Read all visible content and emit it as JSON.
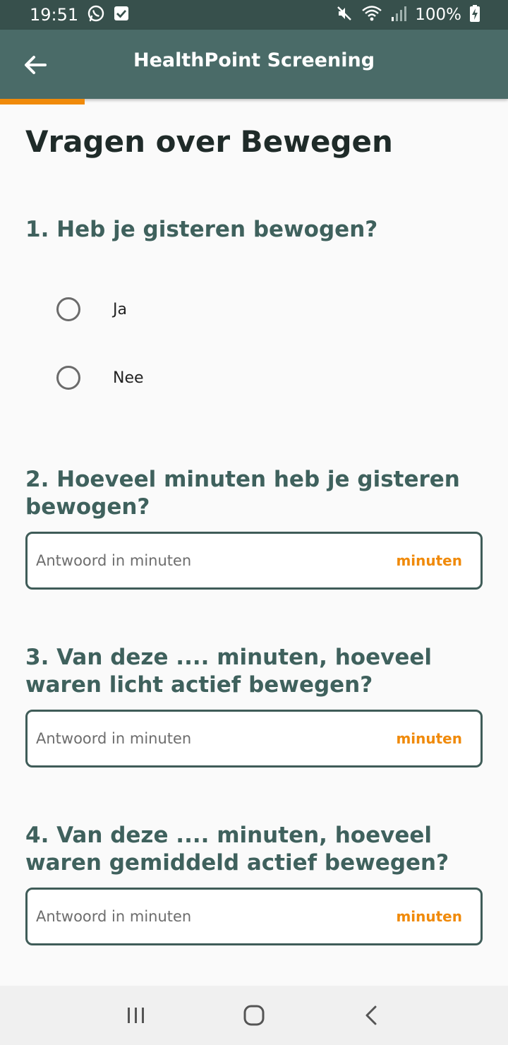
{
  "status_bar": {
    "time": "19:51",
    "battery": "100%"
  },
  "app_bar": {
    "title": "HealthPoint Screening"
  },
  "progress": {
    "fraction": 0.166
  },
  "page": {
    "title": "Vragen over Bewegen"
  },
  "questions": [
    {
      "label": "1. Heb je gisteren bewogen?",
      "options": [
        "Ja",
        "Nee"
      ]
    },
    {
      "label": "2. Hoeveel minuten heb je gisteren bewogen?",
      "placeholder": "Antwoord in minuten",
      "suffix": "minuten"
    },
    {
      "label": "3. Van deze .... minuten, hoeveel waren licht actief bewegen?",
      "placeholder": "Antwoord in minuten",
      "suffix": "minuten"
    },
    {
      "label": "4. Van deze .... minuten, hoeveel waren gemiddeld actief bewegen?",
      "placeholder": "Antwoord in minuten",
      "suffix": "minuten"
    }
  ],
  "colors": {
    "primary": "#4a6b68",
    "status_bar": "#37504c",
    "accent": "#f08a0a",
    "question_text": "#3f615d"
  },
  "icons": {
    "back": "arrow-left-icon",
    "whatsapp": "whatsapp-icon",
    "check": "checkbox-icon",
    "mute": "mute-icon",
    "wifi": "wifi-icon",
    "signal": "signal-icon",
    "battery": "battery-charging-icon",
    "recents": "recents-icon",
    "home": "home-icon",
    "nav_back": "nav-back-icon"
  }
}
